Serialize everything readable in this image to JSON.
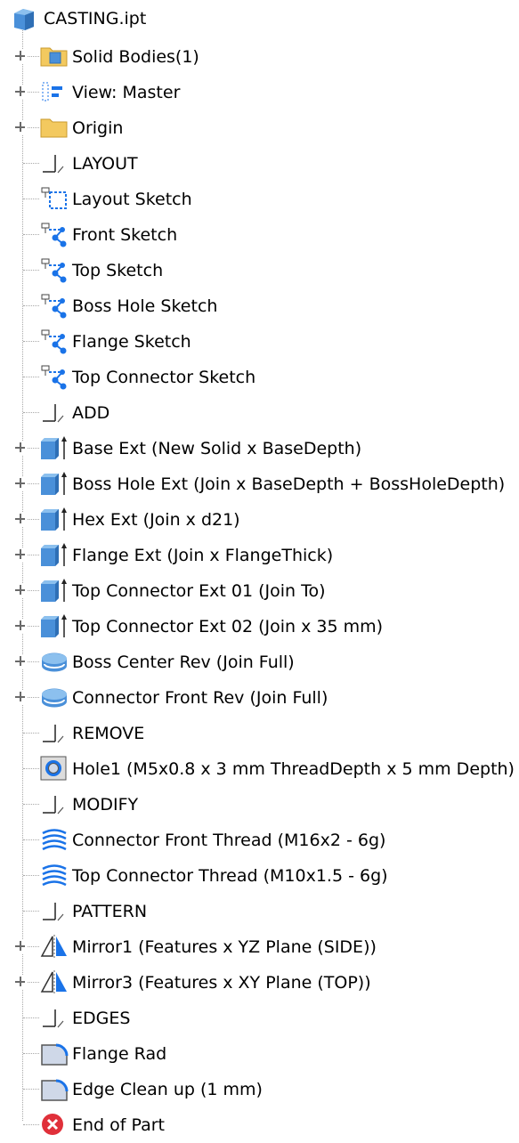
{
  "tree": {
    "root": {
      "label": "CASTING.ipt",
      "icon": "part-icon"
    },
    "items": [
      {
        "label": "Solid Bodies(1)",
        "icon": "solid-bodies-folder-icon",
        "expandable": true
      },
      {
        "label": "View: Master",
        "icon": "view-rep-icon",
        "expandable": true
      },
      {
        "label": "Origin",
        "icon": "folder-icon",
        "expandable": true
      },
      {
        "label": "LAYOUT",
        "icon": "marker-icon",
        "expandable": false
      },
      {
        "label": "Layout Sketch",
        "icon": "sketch-icon",
        "expandable": false
      },
      {
        "label": "Front Sketch",
        "icon": "shared-sketch-icon",
        "expandable": false
      },
      {
        "label": "Top Sketch",
        "icon": "shared-sketch-icon",
        "expandable": false
      },
      {
        "label": "Boss Hole Sketch",
        "icon": "shared-sketch-icon",
        "expandable": false
      },
      {
        "label": "Flange Sketch",
        "icon": "shared-sketch-icon",
        "expandable": false
      },
      {
        "label": "Top Connector Sketch",
        "icon": "shared-sketch-icon",
        "expandable": false
      },
      {
        "label": "ADD",
        "icon": "marker-icon",
        "expandable": false
      },
      {
        "label": "Base Ext (New Solid x BaseDepth)",
        "icon": "extrude-icon",
        "expandable": true
      },
      {
        "label": "Boss Hole Ext (Join x BaseDepth + BossHoleDepth)",
        "icon": "extrude-icon",
        "expandable": true
      },
      {
        "label": "Hex Ext (Join x d21)",
        "icon": "extrude-icon",
        "expandable": true
      },
      {
        "label": "Flange Ext (Join x FlangeThick)",
        "icon": "extrude-icon",
        "expandable": true
      },
      {
        "label": "Top Connector Ext 01 (Join To)",
        "icon": "extrude-icon",
        "expandable": true
      },
      {
        "label": "Top Connector Ext 02 (Join x 35 mm)",
        "icon": "extrude-icon",
        "expandable": true
      },
      {
        "label": "Boss Center Rev (Join Full)",
        "icon": "revolve-icon",
        "expandable": true
      },
      {
        "label": "Connector Front Rev (Join Full)",
        "icon": "revolve-icon",
        "expandable": true
      },
      {
        "label": "REMOVE",
        "icon": "marker-icon",
        "expandable": false
      },
      {
        "label": "Hole1 (M5x0.8 x 3 mm ThreadDepth x 5 mm Depth)",
        "icon": "hole-icon",
        "expandable": false
      },
      {
        "label": "MODIFY",
        "icon": "marker-icon",
        "expandable": false
      },
      {
        "label": "Connector Front Thread (M16x2 - 6g)",
        "icon": "thread-icon",
        "expandable": false
      },
      {
        "label": "Top Connector Thread (M10x1.5 - 6g)",
        "icon": "thread-icon",
        "expandable": false
      },
      {
        "label": "PATTERN",
        "icon": "marker-icon",
        "expandable": false
      },
      {
        "label": "Mirror1 (Features x YZ Plane (SIDE))",
        "icon": "mirror-icon",
        "expandable": true
      },
      {
        "label": "Mirror3 (Features x XY Plane (TOP))",
        "icon": "mirror-icon",
        "expandable": true
      },
      {
        "label": "EDGES",
        "icon": "marker-icon",
        "expandable": false
      },
      {
        "label": "Flange Rad",
        "icon": "fillet-icon",
        "expandable": false
      },
      {
        "label": "Edge Clean up (1 mm)",
        "icon": "fillet-icon",
        "expandable": false
      },
      {
        "label": "End of Part",
        "icon": "end-of-part-icon",
        "expandable": false
      }
    ]
  },
  "colors": {
    "folder": "#f3c95f",
    "solid_blue": "#4a90d9",
    "sketch_blue": "#1a73e8",
    "end_red": "#e0303a",
    "line_gray": "#a8a8a8"
  }
}
